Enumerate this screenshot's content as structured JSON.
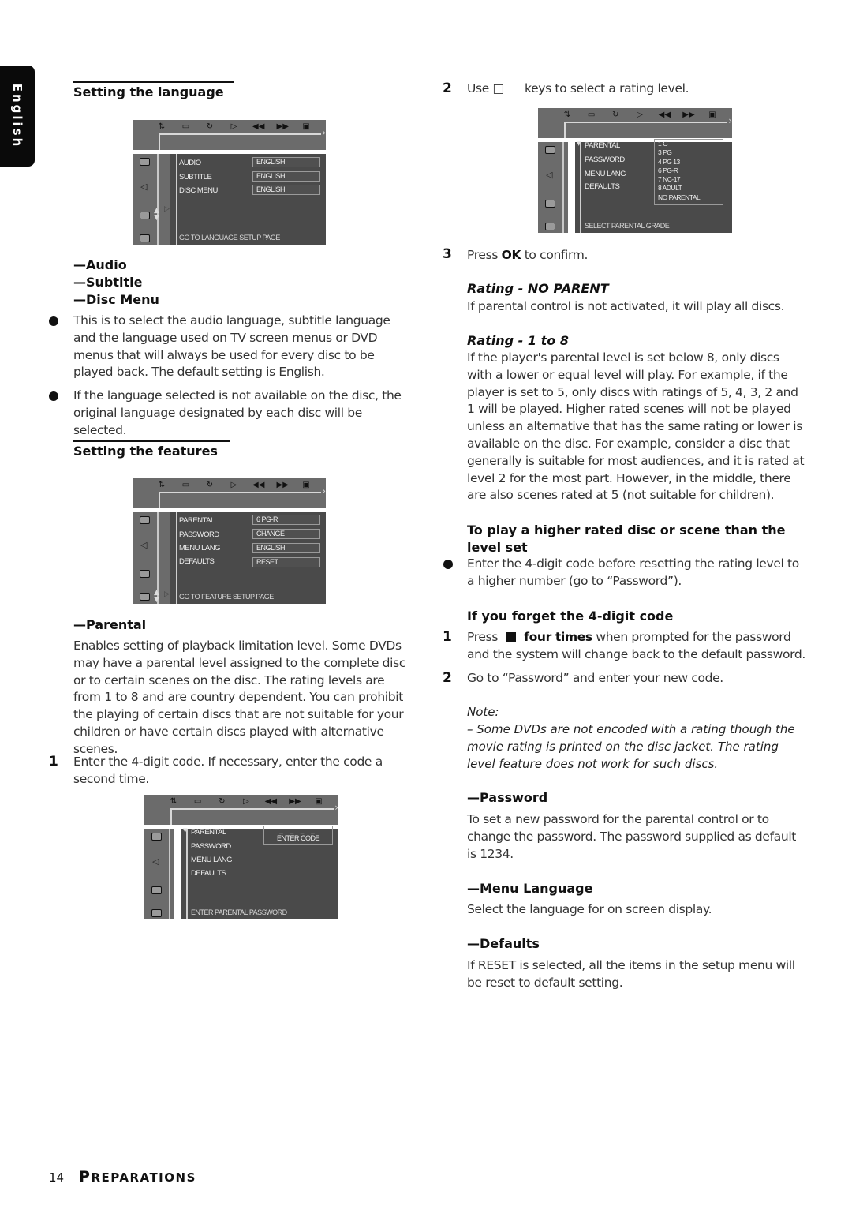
{
  "side_tab": {
    "label": "English"
  },
  "left_column": {
    "language_section": {
      "title": "Setting the language",
      "menu": {
        "toolbar_icons": [
          "settings-icon",
          "subtitle-icon",
          "angle-icon",
          "play-icon",
          "rewind-icon",
          "fast-forward-icon",
          "display-icon"
        ],
        "rows": [
          {
            "label": "AUDIO",
            "value": "ENGLISH"
          },
          {
            "label": "SUBTITLE",
            "value": "ENGLISH"
          },
          {
            "label": "DISC MENU",
            "value": "ENGLISH"
          }
        ],
        "footer": "GO TO LANGUAGE SETUP PAGE"
      },
      "items": [
        "—Audio",
        "—Subtitle",
        "—Disc Menu"
      ],
      "bullets": [
        "This is to select the audio language, subtitle language and the language used on TV screen menus or DVD menus that will always be used for every disc to be played back. The default setting is English.",
        "If the language selected is not available on the disc, the original language designated by each disc will be selected."
      ]
    },
    "features_section": {
      "title": "Setting the features",
      "menu": {
        "rows": [
          {
            "label": "PARENTAL",
            "value": "6 PG-R"
          },
          {
            "label": "PASSWORD",
            "value": "CHANGE"
          },
          {
            "label": "MENU LANG",
            "value": "ENGLISH"
          },
          {
            "label": "DEFAULTS",
            "value": "RESET"
          }
        ],
        "footer": "GO TO FEATURE SETUP PAGE"
      },
      "parental_heading": "—Parental",
      "parental_text": "Enables setting of playback limitation level. Some DVDs may have a parental level assigned to the complete disc or to certain scenes on the disc. The rating levels are from 1 to 8 and are country dependent. You can prohibit the playing of certain discs that are not suitable for your children or have certain discs played with alternative scenes.",
      "step1_num": "1",
      "step1_text": "Enter the 4-digit code. If necessary, enter the code a second time.",
      "password_menu": {
        "rows": [
          "PARENTAL",
          "PASSWORD",
          "MENU LANG",
          "DEFAULTS"
        ],
        "code_dashes": "_ _ _ _",
        "code_label": "ENTER CODE",
        "footer": "ENTER PARENTAL PASSWORD"
      }
    }
  },
  "right_column": {
    "step2_num": "2",
    "step2_text_a": "Use □",
    "step2_text_b": "keys to select a rating level.",
    "grade_menu": {
      "rows": [
        "PARENTAL",
        "PASSWORD",
        "MENU LANG",
        "DEFAULTS"
      ],
      "grades": [
        "1 G",
        "3 PG",
        "4 PG 13",
        "6 PG-R",
        "7 NC-17",
        "8 ADULT",
        "NO PARENTAL"
      ],
      "footer": "SELECT PARENTAL GRADE"
    },
    "step3_num": "3",
    "step3_pre": "Press",
    "step3_key": "OK",
    "step3_post": "to confirm.",
    "rating_no_parent_title": "Rating - NO PARENT",
    "rating_no_parent_text": "If parental control is not activated, it will play all discs.",
    "rating_1_8_title": "Rating - 1 to 8",
    "rating_1_8_text": "If the player's parental level is set below 8, only discs with a lower or equal level will play. For example, if the player is set to 5, only discs with ratings of 5, 4, 3, 2 and 1 will be played.  Higher rated scenes will not be played unless an alternative that has the same rating or lower is available on the disc. For example, consider a disc that generally is suitable for most audiences, and it is rated at level 2 for the most part. However, in the middle, there are also scenes rated at 5 (not suitable for children).",
    "higher_title": "To play a higher rated disc or scene than the level set",
    "higher_bullet": "Enter the 4-digit code before resetting the rating level to a higher number (go to “Password”).",
    "forget_title": "If you forget the 4-digit code",
    "forget_step1_num": "1",
    "forget_step1_pre": "Press",
    "forget_step1_key": "four times",
    "forget_step1_post": "when prompted for the password and the system will change back to the default password.",
    "forget_step2_num": "2",
    "forget_step2_text": "Go to “Password” and enter your new code.",
    "note_label": "Note:",
    "note_text": "–  Some DVDs are not encoded with a rating though the movie rating is printed on the disc jacket. The rating level feature does not work for such discs.",
    "password_heading": "—Password",
    "password_text": "To set a new password for the parental control or to change the password. The password supplied as default is 1234.",
    "menu_lang_heading": "—Menu Language",
    "menu_lang_text": "Select the language for on screen display.",
    "defaults_heading": "—Defaults",
    "defaults_text": "If RESET is selected, all the items in the setup menu will be reset to default setting."
  },
  "footer": {
    "page_number": "14",
    "section_cap": "P",
    "section_rest": "REPARATIONS"
  }
}
